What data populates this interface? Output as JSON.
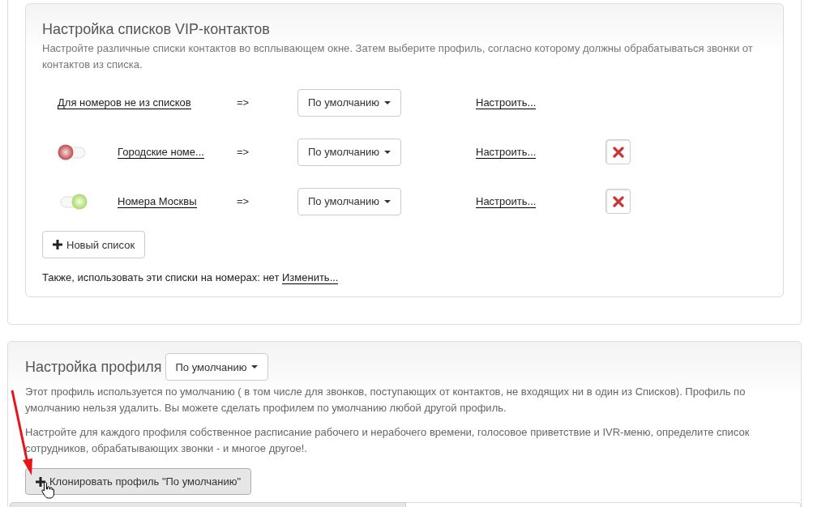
{
  "vip_section": {
    "title": "Настройка списков VIP-контактов",
    "description": "Настройте различные списки контактов во всплывающем окне. Затем выберите профиль, согласно которому должны обрабатываться звонки от контактов из списка.",
    "rows": [
      {
        "kind": "default",
        "name": "Для номеров не из списков",
        "arrow": "=>",
        "profile": "По умолчанию",
        "configure": "Настроить..."
      },
      {
        "kind": "list",
        "on": false,
        "name": "Городские номе...",
        "arrow": "=>",
        "profile": "По умолчанию",
        "configure": "Настроить..."
      },
      {
        "kind": "list",
        "on": true,
        "name": "Номера Москвы",
        "arrow": "=>",
        "profile": "По умолчанию",
        "configure": "Настроить..."
      }
    ],
    "new_list_button": "Новый список",
    "footer_text": "Также, использовать эти списки на номерах: нет",
    "footer_link": "Изменить..."
  },
  "profile_section": {
    "title": "Настройка профиля",
    "profile": "По умолчанию",
    "paragraphs": [
      "Этот профиль используется по умолчанию ( в том числе для звонков, поступающих от контактов, не входящих ни в один из Списков). Профиль по умолчанию нельзя удалить. Вы можете сделать профилем по умолчанию любой другой профиль.",
      "Настройте для каждого профиля собственное расписание рабочего и нерабочего времени, голосовое приветствие и IVR-меню, определите список сотрудников, обрабатывающих звонки - и многое другое!."
    ],
    "clone_button": "Клонировать профиль \"По умолчанию\""
  }
}
